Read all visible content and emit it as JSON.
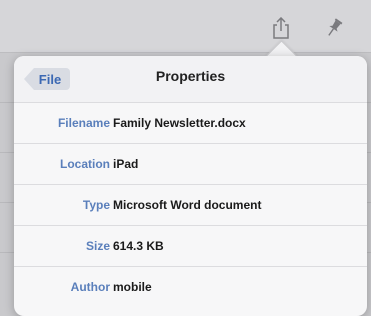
{
  "toolbar": {
    "share_icon": "share-icon",
    "pin_icon": "pin-icon"
  },
  "popover": {
    "back_label": "File",
    "title": "Properties",
    "rows": [
      {
        "label": "Filename",
        "value": "Family Newsletter.docx"
      },
      {
        "label": "Location",
        "value": "iPad"
      },
      {
        "label": "Type",
        "value": "Microsoft Word document"
      },
      {
        "label": "Size",
        "value": "614.3 KB"
      },
      {
        "label": "Author",
        "value": "mobile"
      }
    ]
  },
  "colors": {
    "accent": "#3b68b3",
    "label": "#5a7fbb",
    "background": "#c9c9cc"
  }
}
